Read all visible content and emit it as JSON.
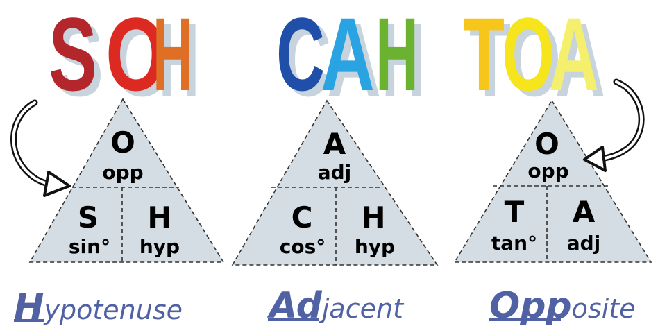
{
  "mnemonics": [
    {
      "letters": [
        {
          "char": "S",
          "color": "#b3262c"
        },
        {
          "char": "O",
          "color": "#dc2a22"
        },
        {
          "char": "H",
          "color": "#e06f26"
        }
      ],
      "triangle": {
        "top_letter": "O",
        "top_word": "opp",
        "left_letter": "S",
        "left_word": "sin°",
        "right_letter": "H",
        "right_word": "hyp"
      },
      "word": {
        "first": "H",
        "rest": "ypotenuse"
      }
    },
    {
      "letters": [
        {
          "char": "C",
          "color": "#1f4fa8"
        },
        {
          "char": "A",
          "color": "#2aa3e2"
        },
        {
          "char": "H",
          "color": "#6ab22f"
        }
      ],
      "triangle": {
        "top_letter": "A",
        "top_word": "adj",
        "left_letter": "C",
        "left_word": "cos°",
        "right_letter": "H",
        "right_word": "hyp"
      },
      "word": {
        "first": "Ad",
        "rest": "jacent"
      }
    },
    {
      "letters": [
        {
          "char": "T",
          "color": "#f6c61b"
        },
        {
          "char": "O",
          "color": "#f6e41c"
        },
        {
          "char": "A",
          "color": "#f4f06e"
        }
      ],
      "triangle": {
        "top_letter": "O",
        "top_word": "opp",
        "left_letter": "T",
        "left_word": "tan°",
        "right_letter": "A",
        "right_word": "adj"
      },
      "word": {
        "first": "Opp",
        "rest": "osite"
      }
    }
  ],
  "colors": {
    "triangle_fill": "#d4dde3",
    "triangle_line": "#333333",
    "word": "#5061a4",
    "letter_shadow": "#c7d4de",
    "arrow": "#111111"
  },
  "icons": [
    "curved-arrow-icon",
    "curved-arrow-icon"
  ]
}
